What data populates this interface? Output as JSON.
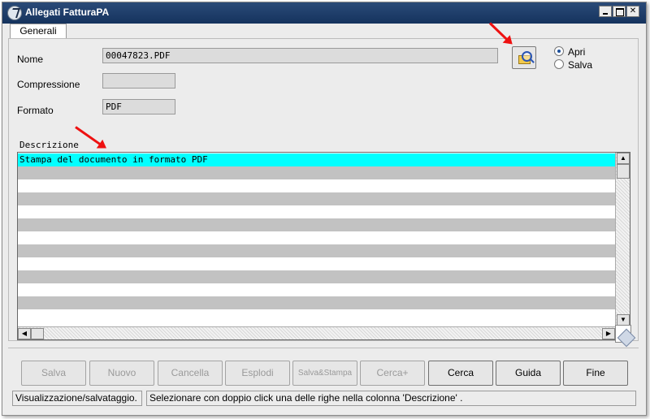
{
  "window": {
    "title": "Allegati FatturaPA"
  },
  "tabs": [
    {
      "label": "Generali"
    }
  ],
  "form": {
    "nome": {
      "label": "Nome",
      "value": "00047823.PDF"
    },
    "compressione": {
      "label": "Compressione",
      "value": ""
    },
    "formato": {
      "label": "Formato",
      "value": "PDF"
    }
  },
  "mode": {
    "options": [
      {
        "label": "Apri",
        "selected": true
      },
      {
        "label": "Salva",
        "selected": false
      }
    ]
  },
  "descrizione": {
    "label": "Descrizione",
    "rows": [
      "Stampa del documento in formato PDF",
      "",
      "",
      "",
      "",
      "",
      "",
      "",
      "",
      "",
      "",
      "",
      ""
    ]
  },
  "buttons": [
    {
      "label": "Salva",
      "enabled": false
    },
    {
      "label": "Nuovo",
      "enabled": false
    },
    {
      "label": "Cancella",
      "enabled": false
    },
    {
      "label": "Esplodi",
      "enabled": false
    },
    {
      "label": "Salva&Stampa",
      "enabled": false
    },
    {
      "label": "Cerca+",
      "enabled": false
    },
    {
      "label": "Cerca",
      "enabled": true
    },
    {
      "label": "Guida",
      "enabled": true
    },
    {
      "label": "Fine",
      "enabled": true
    }
  ],
  "status": {
    "left": "Visualizzazione/salvataggio.",
    "right": "Selezionare con doppio click una delle righe nella colonna 'Descrizione' ."
  },
  "colors": {
    "titlebar": "#1f3d6b",
    "selected_row": "#00ffff",
    "stripe_row": "#c2c2c2",
    "annotation_arrow": "#ee1111"
  },
  "icons": {
    "window": "app-icon",
    "browse": "folder-magnifier-icon"
  }
}
